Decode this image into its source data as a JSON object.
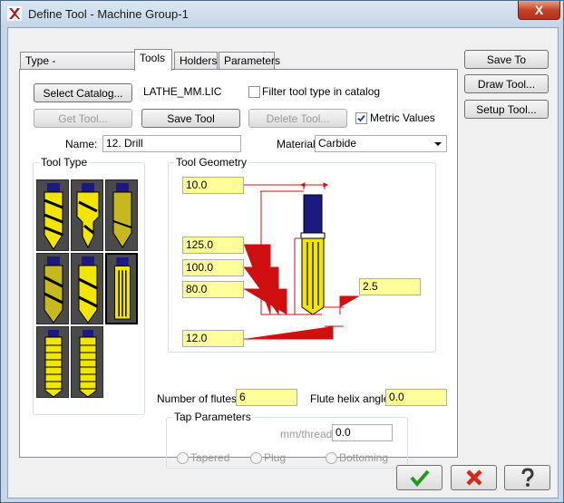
{
  "window": {
    "title": "Define Tool - Machine Group-1",
    "close_glyph": "X"
  },
  "tabs": [
    {
      "label": "Type - Drill/Tap/Reamer"
    },
    {
      "label": "Tools"
    },
    {
      "label": "Holders"
    },
    {
      "label": "Parameters"
    }
  ],
  "catalog": {
    "select_label": "Select Catalog...",
    "file": "LATHE_MM.LIC",
    "filter_label": "Filter tool type in catalog",
    "filter_checked": false,
    "get_tool_label": "Get Tool...",
    "save_tool_label": "Save Tool",
    "delete_tool_label": "Delete Tool...",
    "metric_label": "Metric Values",
    "metric_checked": true
  },
  "name": {
    "label": "Name:",
    "value": "12. Drill"
  },
  "material": {
    "label": "Material",
    "value": "Carbide"
  },
  "tool_type": {
    "label": "Tool Type"
  },
  "geometry": {
    "label": "Tool Geometry",
    "values": [
      "10.0",
      "125.0",
      "100.0",
      "80.0",
      "12.0",
      "2.5"
    ]
  },
  "flutes": {
    "label": "Number of flutes:",
    "value": "6"
  },
  "helix": {
    "label": "Flute helix angle:",
    "value": "0.0"
  },
  "tap": {
    "label": "Tap Parameters",
    "thread_label": "mm/thread",
    "thread_value": "0.0",
    "options": [
      "Tapered",
      "Plug",
      "Bottoming"
    ]
  },
  "side_buttons": [
    "Save To Library...",
    "Draw Tool...",
    "Setup Tool..."
  ],
  "colors": {
    "accent": "#ffff99",
    "tool_yellow": "#f2e600",
    "shank": "#1a1a80"
  }
}
